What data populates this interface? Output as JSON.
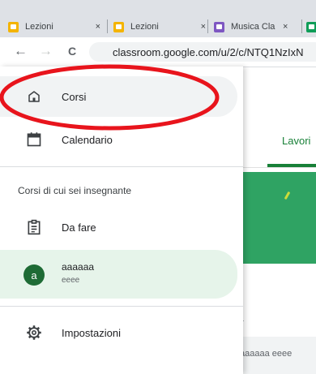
{
  "browser": {
    "tabs": [
      {
        "title": "Lezioni",
        "close": "×",
        "icon": "slides-icon",
        "icon_color": "#f4b400"
      },
      {
        "title": "Lezioni",
        "close": "×",
        "icon": "slides-icon",
        "icon_color": "#f4b400"
      },
      {
        "title": "Musica Cla",
        "close": "×",
        "icon": "forms-icon",
        "icon_color": "#7e57c2"
      },
      {
        "title": "",
        "close": "",
        "icon": "classroom-icon",
        "icon_color": "#0f9d58"
      }
    ],
    "back": "←",
    "forward": "→",
    "reload": "C",
    "url": "classroom.google.com/u/2/c/NTQ1NzIxN"
  },
  "background": {
    "nav_tab": "Lavori",
    "bottom_text": "aaaaaa eeee",
    "dots": "·",
    "accent_color": "#188038",
    "banner_color": "#2fa363"
  },
  "drawer": {
    "items": [
      {
        "label": "Corsi",
        "icon": "home-icon"
      },
      {
        "label": "Calendario",
        "icon": "calendar-icon"
      }
    ],
    "section_heading": "Corsi di cui sei insegnante",
    "todo": {
      "label": "Da fare",
      "icon": "assignment-icon"
    },
    "course": {
      "avatar_letter": "a",
      "name": "aaaaaa",
      "section": "eeee",
      "avatar_color": "#1e6b35"
    },
    "settings": {
      "label": "Impostazioni",
      "icon": "gear-icon"
    },
    "selected_bg": "#e8f0fe",
    "hover_bg": "#f1f3f4",
    "selected_course_bg": "#e6f4ea"
  },
  "annotation": {
    "color": "#e8141c",
    "shape": "ellipse"
  }
}
